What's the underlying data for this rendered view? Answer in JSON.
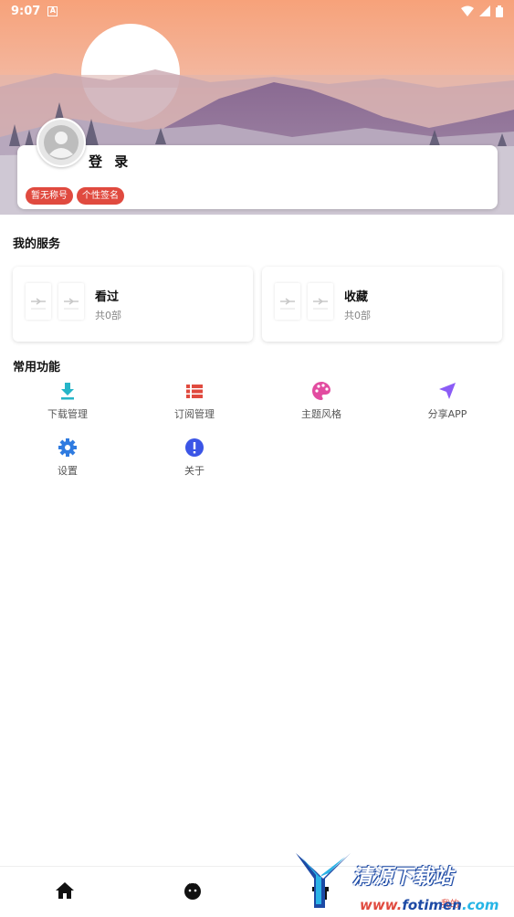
{
  "status_bar": {
    "time": "9:07",
    "notification_glyph": "A"
  },
  "profile": {
    "login_label": "登 录",
    "tags": [
      "暂无称号",
      "个性签名"
    ]
  },
  "services": {
    "title": "我的服务",
    "items": [
      {
        "title": "看过",
        "count": "共0部"
      },
      {
        "title": "收藏",
        "count": "共0部"
      }
    ]
  },
  "functions": {
    "title": "常用功能",
    "items": [
      {
        "label": "下载管理",
        "icon": "download-icon",
        "color": "#26b5c8"
      },
      {
        "label": "订阅管理",
        "icon": "list-icon",
        "color": "#e04a3f"
      },
      {
        "label": "主题风格",
        "icon": "palette-icon",
        "color": "#e24ca0"
      },
      {
        "label": "分享APP",
        "icon": "send-icon",
        "color": "#8b5cf6"
      },
      {
        "label": "设置",
        "icon": "gear-icon",
        "color": "#2f7be0"
      },
      {
        "label": "关于",
        "icon": "info-icon",
        "color": "#3b55e6"
      }
    ]
  },
  "bottom_nav": {
    "items": [
      {
        "icon": "home-icon"
      },
      {
        "icon": "face-icon"
      },
      {
        "icon": "gift-icon",
        "label": "我的"
      }
    ]
  },
  "watermark": {
    "name": "清源下载站",
    "url_part1": "www.",
    "url_part2": "fotimen",
    "url_part3": ".com"
  },
  "colors": {
    "accent": "#e04a3f",
    "sky_top": "#f6a57c",
    "mountain": "#7a6890"
  }
}
